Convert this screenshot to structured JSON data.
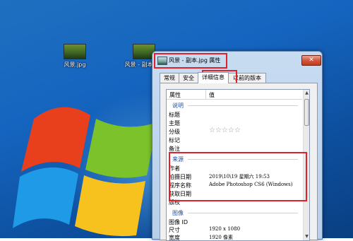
{
  "desktop": {
    "icons": [
      {
        "label": "风景.jpg"
      },
      {
        "label": "风景 - 副本.jpg"
      }
    ]
  },
  "dialog": {
    "title": "风景 - 副本.jpg 属性",
    "close_label": "✕",
    "tabs": [
      "常规",
      "安全",
      "详细信息",
      "以前的版本"
    ],
    "active_tab": "详细信息",
    "columns": {
      "name": "属性",
      "value": "值"
    },
    "sections": {
      "description": {
        "label": "说明",
        "rows": [
          {
            "k": "标题",
            "v": ""
          },
          {
            "k": "主题",
            "v": ""
          },
          {
            "k": "分级",
            "v": ""
          },
          {
            "k": "标记",
            "v": ""
          },
          {
            "k": "备注",
            "v": ""
          }
        ]
      },
      "origin": {
        "label": "来源",
        "rows": [
          {
            "k": "作者",
            "v": ""
          },
          {
            "k": "拍摄日期",
            "v": "2019\\10\\19 星期六 19:53"
          },
          {
            "k": "程序名称",
            "v": "Adobe Photoshop CS6 (Windows)"
          },
          {
            "k": "获取日期",
            "v": ""
          },
          {
            "k": "版权",
            "v": ""
          }
        ]
      },
      "image": {
        "label": "图像",
        "rows": [
          {
            "k": "图像 ID",
            "v": ""
          },
          {
            "k": "尺寸",
            "v": "1920 x 1080"
          },
          {
            "k": "宽度",
            "v": "1920 像素"
          },
          {
            "k": "高度",
            "v": "1080 像素"
          }
        ]
      }
    },
    "rating_stars": "☆☆☆☆☆"
  },
  "colors": {
    "highlight_box": "#e0202a",
    "section_label": "#1e50a8"
  }
}
